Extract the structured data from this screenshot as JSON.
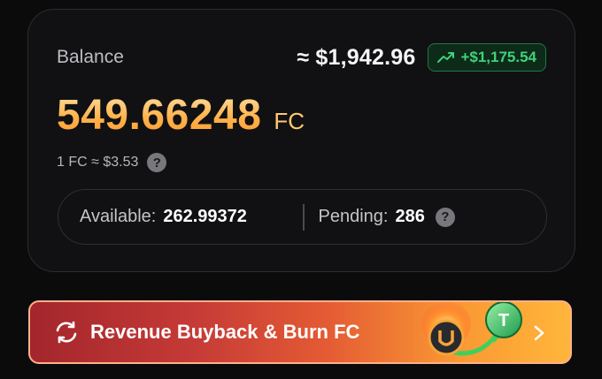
{
  "balance": {
    "label": "Balance",
    "usd_value": "≈ $1,942.96",
    "gain": "+$1,175.54",
    "amount": "549.66248",
    "unit": "FC",
    "rate": "1 FC ≈ $3.53"
  },
  "stats": {
    "available_label": "Available:",
    "available_value": "262.99372",
    "pending_label": "Pending:",
    "pending_value": "286"
  },
  "banner": {
    "title": "Revenue Buyback & Burn FC"
  },
  "icons": {
    "trend": "trend-up-icon",
    "help": "question-icon",
    "swap": "swap-icon",
    "chevron": "chevron-right-icon"
  },
  "colors": {
    "gain": "#3fd27a",
    "amount": "#ffb24a",
    "banner_start": "#a3262c",
    "banner_end": "#ffb63b"
  }
}
